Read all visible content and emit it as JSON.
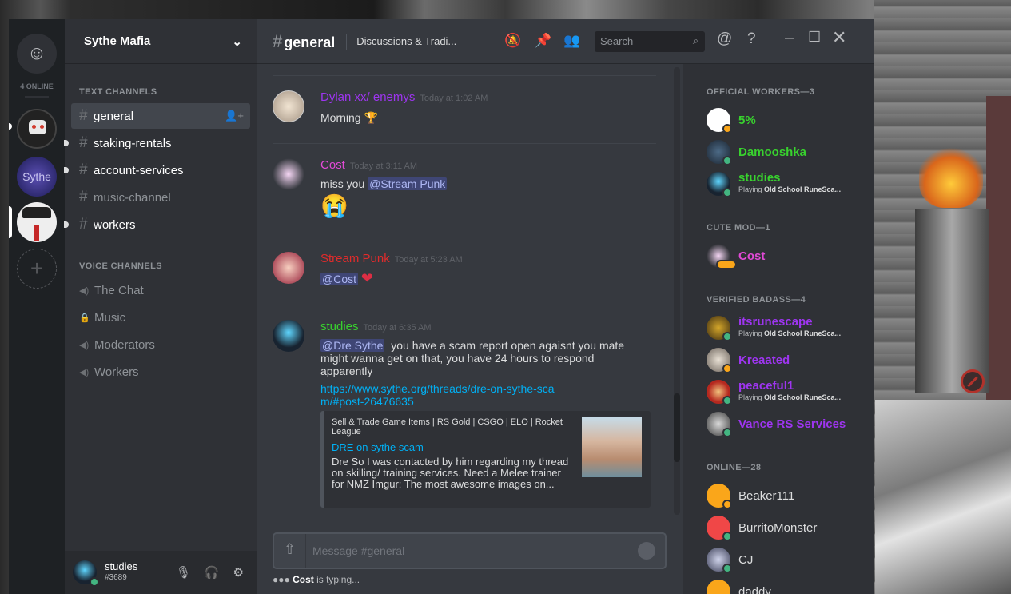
{
  "server": {
    "name": "Sythe Mafia"
  },
  "guilds": {
    "online_count": "4 ONLINE",
    "g2_label": "Sythe"
  },
  "channels": {
    "text_header": "TEXT CHANNELS",
    "voice_header": "VOICE CHANNELS",
    "text": [
      "general",
      "staking-rentals",
      "account-services",
      "music-channel",
      "workers"
    ],
    "voice": [
      "The Chat",
      "Music",
      "Moderators",
      "Workers"
    ]
  },
  "user": {
    "name": "studies",
    "tag": "#3689"
  },
  "header": {
    "channel": "general",
    "topic": "Discussions & Tradi...",
    "search_placeholder": "Search"
  },
  "messages": [
    {
      "author": "Dylan xx/ enemys",
      "color": "#9e35f0",
      "time": "Today at 1:02 AM",
      "text": "Morning"
    },
    {
      "author": "Cost",
      "color": "#e14ad6",
      "time": "Today at 3:11 AM",
      "text": "miss you",
      "mention": "@Stream Punk"
    },
    {
      "author": "Stream Punk",
      "color": "#e02b2b",
      "time": "Today at 5:23 AM",
      "mention": "@Cost"
    },
    {
      "author": "studies",
      "color": "#38d22e",
      "time": "Today at 6:35 AM",
      "mention": "@Dre Sythe",
      "text": "you have a scam report open agaisnt you mate might wanna get on that, you have 24 hours to respond apparently",
      "link": "https://www.sythe.org/threads/dre-on-sythe-scam/#post-26476635"
    }
  ],
  "embed": {
    "provider": "Sell & Trade Game Items | RS Gold | CSGO | ELO | Rocket League",
    "title": "DRE on sythe scam",
    "description": "Dre So I was contacted by him regarding my thread on skilling/ training services. Need a Melee trainer for NMZ Imgur: The most awesome images on..."
  },
  "composer": {
    "placeholder": "Message #general"
  },
  "typing": {
    "who": "Cost",
    "text": "is typing..."
  },
  "members": {
    "groups": [
      {
        "title": "OFFICIAL WORKERS—3",
        "items": [
          {
            "name": "5%",
            "color": "#38d22e"
          },
          {
            "name": "Damooshka",
            "color": "#38d22e"
          },
          {
            "name": "studies",
            "color": "#38d22e",
            "playing": "Playing",
            "game": "Old School RuneSca..."
          }
        ]
      },
      {
        "title": "CUTE MOD—1",
        "items": [
          {
            "name": "Cost",
            "color": "#e14ad6"
          }
        ]
      },
      {
        "title": "VERIFIED BADASS—4",
        "items": [
          {
            "name": "itsrunescape",
            "color": "#9e35f0",
            "playing": "Playing",
            "game": "Old School RuneSca..."
          },
          {
            "name": "Kreaated",
            "color": "#9e35f0"
          },
          {
            "name": "peaceful1",
            "color": "#9e35f0",
            "playing": "Playing",
            "game": "Old School RuneSca..."
          },
          {
            "name": "Vance RS Services",
            "color": "#9e35f0"
          }
        ]
      },
      {
        "title": "ONLINE—28",
        "items": [
          {
            "name": "Beaker111",
            "color": "#dcddde"
          },
          {
            "name": "BurritoMonster",
            "color": "#dcddde"
          },
          {
            "name": "CJ",
            "color": "#dcddde"
          },
          {
            "name": "daddy",
            "color": "#dcddde"
          }
        ]
      }
    ]
  }
}
